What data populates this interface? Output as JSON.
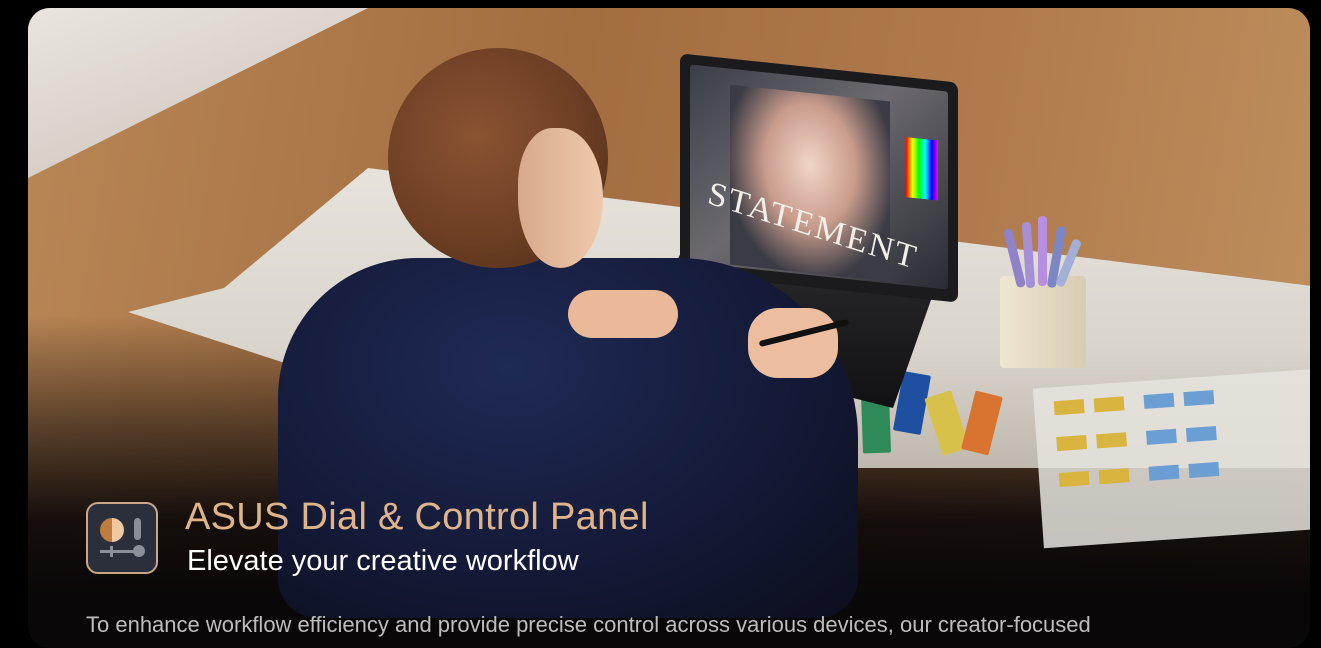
{
  "hero": {
    "screen_word": "STATEMENT"
  },
  "feature": {
    "icon": "dial-control-panel-icon",
    "title": "ASUS Dial & Control Panel",
    "subtitle": "Elevate your creative workflow",
    "description": "To enhance workflow efficiency and provide precise control across various devices, our creator-focused"
  },
  "colors": {
    "title": "#dfb48b",
    "subtitle": "#ffffff",
    "description": "#bdbdbd",
    "background": "#000000"
  }
}
